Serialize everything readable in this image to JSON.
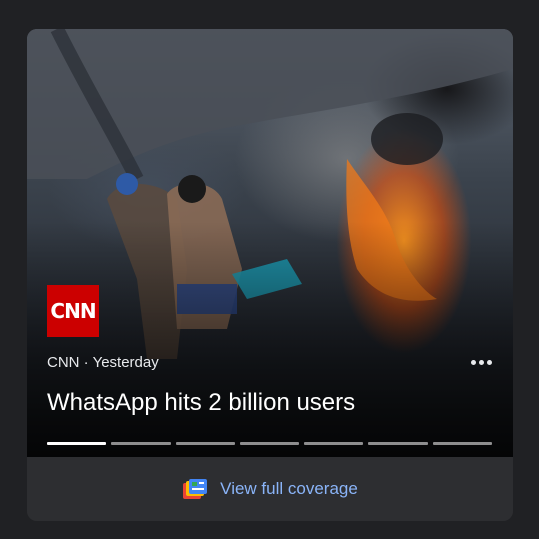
{
  "story": {
    "source_logo_text": "CNN",
    "source": "CNN",
    "time": "Yesterday",
    "meta_separator": " · ",
    "headline": "WhatsApp hits 2 billion users",
    "image_icon": "news-photo",
    "progress": {
      "total_segments": 7,
      "active_index": 0
    }
  },
  "footer": {
    "label": "View full coverage",
    "icon": "full-coverage-icon"
  },
  "colors": {
    "background": "#202124",
    "card": "#2d2e31",
    "link": "#8ab4f8",
    "brand_red": "#cc0000"
  }
}
